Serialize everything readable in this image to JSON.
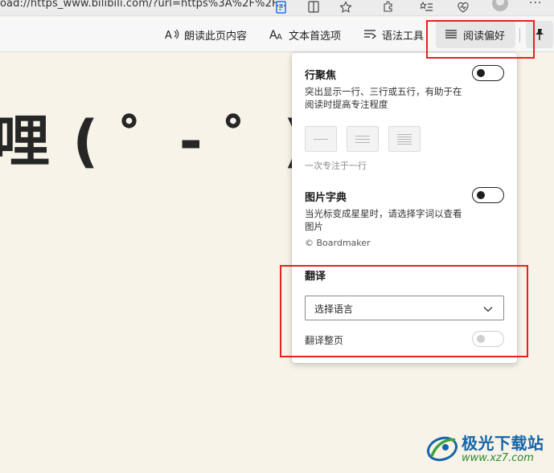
{
  "browser": {
    "address_text": "oad://https_www.bilibili.com/?url=https%3A%2F%2F..."
  },
  "toolbar": {
    "read_aloud_label": "朗读此页内容",
    "text_prefs_label": "文本首选项",
    "grammar_tools_label": "语法工具",
    "reading_prefs_label": "阅读偏好"
  },
  "article": {
    "title_fragment": "哩 ( ゜- ゜)つロ"
  },
  "panel": {
    "line_focus": {
      "title": "行聚焦",
      "description": "突出显示一行、三行或五行，有助于在阅读时提高专注程度",
      "enabled": true,
      "hint": "一次专注于一行"
    },
    "picture_dictionary": {
      "title": "图片字典",
      "description": "当光标变成星星时，请选择字词以查看图片",
      "enabled": true,
      "credit": "© Boardmaker"
    },
    "translate": {
      "title": "翻译",
      "select_placeholder": "选择语言",
      "translate_page_label": "翻译整页",
      "translate_page_enabled": false
    }
  },
  "watermark": {
    "name": "极光下载站",
    "url": "www.xz7.com"
  },
  "colors": {
    "page_background": "#f7f3e8",
    "highlight": "#e8211d",
    "watermark_blue": "#1565a8",
    "watermark_green": "#2a8a2a"
  }
}
